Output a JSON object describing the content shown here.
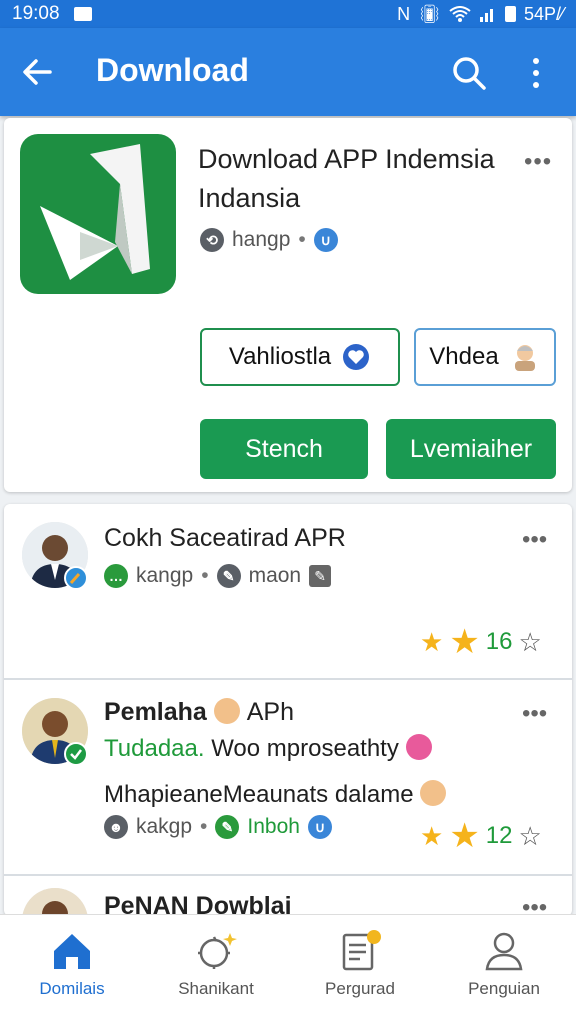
{
  "status_bar": {
    "time": "19:08",
    "battery": "54P/⁄"
  },
  "app_bar": {
    "title": "Download"
  },
  "app_card": {
    "name": "Download APP Indemsia Indansia",
    "meta_label": "hangp",
    "secondary_buttons": [
      {
        "label": "Vahliostla"
      },
      {
        "label": "Vhdea"
      }
    ],
    "primary_buttons": [
      {
        "label": "Stench"
      },
      {
        "label": "Lvemiaiher"
      }
    ]
  },
  "posts": [
    {
      "title": "Cokh Saceatirad APR",
      "meta1": "kangp",
      "meta2": "maon",
      "rating": "16"
    },
    {
      "title": "Pemlaha",
      "title_suffix": "APh",
      "line1_green": "Tudadaa.",
      "line1": "Woo mproseathty",
      "line2": "MhapieaneMeaunats dalame",
      "meta1": "kakgp",
      "meta2": "Inboh",
      "rating": "12"
    },
    {
      "title": "PeNAN Dowblai"
    }
  ],
  "bottom_nav": [
    {
      "label": "Domilais",
      "active": true
    },
    {
      "label": "Shanikant",
      "active": false
    },
    {
      "label": "Pergurad",
      "active": false
    },
    {
      "label": "Penguian",
      "active": false
    }
  ],
  "colors": {
    "primary": "#2a7fdf",
    "green": "#1a9a52",
    "star": "#f5b31b"
  }
}
